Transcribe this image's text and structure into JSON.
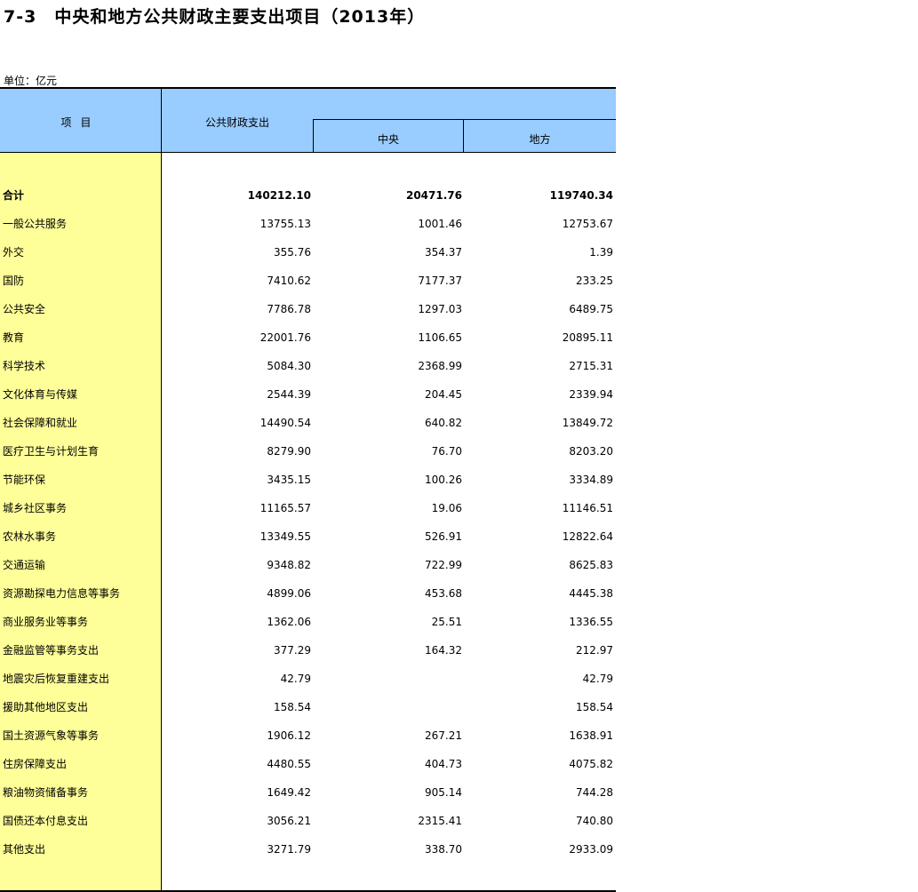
{
  "title": "7-3　中央和地方公共财政主要支出项目（2013年）",
  "unit": "单位：亿元",
  "headers": {
    "item": "项目",
    "total": "公共财政支出",
    "central": "中央",
    "local": "地方"
  },
  "rows": [
    {
      "label": "合计",
      "total": "140212.10",
      "central": "20471.76",
      "local": "119740.34"
    },
    {
      "label": "一般公共服务",
      "total": "13755.13",
      "central": "1001.46",
      "local": "12753.67"
    },
    {
      "label": "外交",
      "total": "355.76",
      "central": "354.37",
      "local": "1.39"
    },
    {
      "label": "国防",
      "total": "7410.62",
      "central": "7177.37",
      "local": "233.25"
    },
    {
      "label": "公共安全",
      "total": "7786.78",
      "central": "1297.03",
      "local": "6489.75"
    },
    {
      "label": "教育",
      "total": "22001.76",
      "central": "1106.65",
      "local": "20895.11"
    },
    {
      "label": "科学技术",
      "total": "5084.30",
      "central": "2368.99",
      "local": "2715.31"
    },
    {
      "label": "文化体育与传媒",
      "total": "2544.39",
      "central": "204.45",
      "local": "2339.94"
    },
    {
      "label": "社会保障和就业",
      "total": "14490.54",
      "central": "640.82",
      "local": "13849.72"
    },
    {
      "label": "医疗卫生与计划生育",
      "total": "8279.90",
      "central": "76.70",
      "local": "8203.20"
    },
    {
      "label": "节能环保",
      "total": "3435.15",
      "central": "100.26",
      "local": "3334.89"
    },
    {
      "label": "城乡社区事务",
      "total": "11165.57",
      "central": "19.06",
      "local": "11146.51"
    },
    {
      "label": "农林水事务",
      "total": "13349.55",
      "central": "526.91",
      "local": "12822.64"
    },
    {
      "label": "交通运输",
      "total": "9348.82",
      "central": "722.99",
      "local": "8625.83"
    },
    {
      "label": "资源勘探电力信息等事务",
      "total": "4899.06",
      "central": "453.68",
      "local": "4445.38"
    },
    {
      "label": "商业服务业等事务",
      "total": "1362.06",
      "central": "25.51",
      "local": "1336.55"
    },
    {
      "label": "金融监管等事务支出",
      "total": "377.29",
      "central": "164.32",
      "local": "212.97"
    },
    {
      "label": "地震灾后恢复重建支出",
      "total": "42.79",
      "central": "",
      "local": "42.79"
    },
    {
      "label": "援助其他地区支出",
      "total": "158.54",
      "central": "",
      "local": "158.54"
    },
    {
      "label": "国土资源气象等事务",
      "total": "1906.12",
      "central": "267.21",
      "local": "1638.91"
    },
    {
      "label": "住房保障支出",
      "total": "4480.55",
      "central": "404.73",
      "local": "4075.82"
    },
    {
      "label": "粮油物资储备事务",
      "total": "1649.42",
      "central": "905.14",
      "local": "744.28"
    },
    {
      "label": "国债还本付息支出",
      "total": "3056.21",
      "central": "2315.41",
      "local": "740.80"
    },
    {
      "label": "其他支出",
      "total": "3271.79",
      "central": "338.70",
      "local": "2933.09"
    }
  ]
}
